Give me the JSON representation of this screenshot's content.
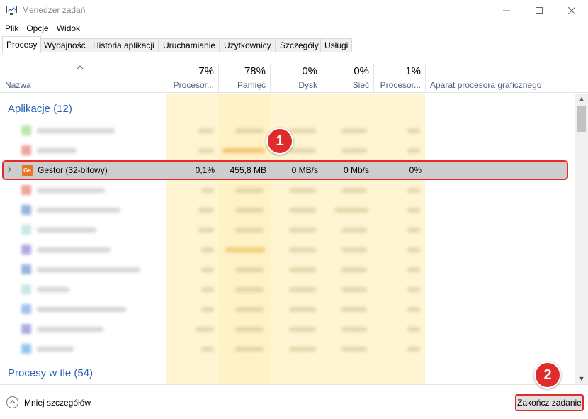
{
  "window": {
    "title": "Menedżer zadań"
  },
  "menu": [
    "Plik",
    "Opcje",
    "Widok"
  ],
  "tabs": [
    "Procesy",
    "Wydajność",
    "Historia aplikacji",
    "Uruchamianie",
    "Użytkownicy",
    "Szczegóły",
    "Usługi"
  ],
  "header": {
    "name": "Nazwa",
    "cpu": {
      "pct": "7%",
      "label": "Procesor..."
    },
    "memory": {
      "pct": "78%",
      "label": "Pamięć"
    },
    "disk": {
      "pct": "0%",
      "label": "Dysk"
    },
    "network": {
      "pct": "0%",
      "label": "Sieć"
    },
    "gpu": {
      "pct": "1%",
      "label": "Procesor..."
    },
    "gpu_engine": "Aparat procesora graficznego"
  },
  "groups": {
    "apps": "Aplikacje (12)",
    "background": "Procesy w tle (54)"
  },
  "selected_row": {
    "icon_text": "Gs",
    "name": "Gestor (32-bitowy)",
    "cpu": "0,1%",
    "memory": "455,8 MB",
    "disk": "0 MB/s",
    "network": "0 Mb/s",
    "gpu": "0%"
  },
  "footer": {
    "less_details": "Mniej szczegółów",
    "end_task": "Zakończ zadanie"
  },
  "annotations": {
    "step1": "1",
    "step2": "2"
  },
  "colors": {
    "accent": "#2a62b8",
    "highlight": "#e52a2a",
    "heat_light": "#fff5d2",
    "heat_medium": "#ffe9a8"
  }
}
